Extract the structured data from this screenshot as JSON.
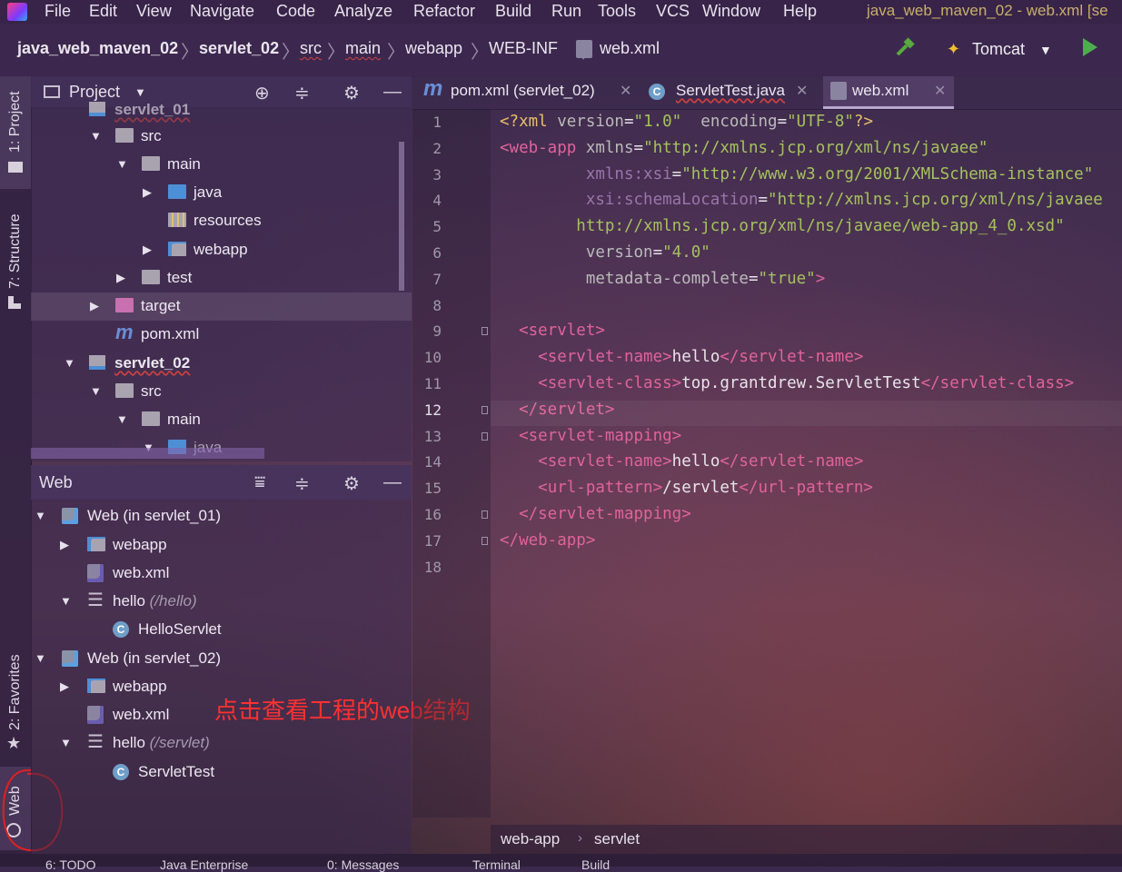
{
  "menu": {
    "items": [
      "File",
      "Edit",
      "View",
      "Navigate",
      "Code",
      "Analyze",
      "Refactor",
      "Build",
      "Run",
      "Tools",
      "VCS",
      "Window",
      "Help"
    ],
    "window_title": "java_web_maven_02 - web.xml [se"
  },
  "navbar": {
    "breadcrumbs": [
      "java_web_maven_02",
      "servlet_02",
      "src",
      "main",
      "webapp",
      "WEB-INF",
      "web.xml"
    ],
    "run_config": "Tomcat"
  },
  "left_tabs": [
    "1: Project",
    "7: Structure",
    "2: Favorites",
    "Web"
  ],
  "project_panel": {
    "title": "Project",
    "rows": [
      {
        "label": "servlet_01",
        "depth": 1,
        "type": "module",
        "partial": true
      },
      {
        "label": "src",
        "depth": 2,
        "type": "folder",
        "expanded": true
      },
      {
        "label": "main",
        "depth": 3,
        "type": "folder",
        "expanded": true
      },
      {
        "label": "java",
        "depth": 4,
        "type": "folder-blue",
        "expanded": false
      },
      {
        "label": "resources",
        "depth": 4,
        "type": "folder-res"
      },
      {
        "label": "webapp",
        "depth": 4,
        "type": "folder-web",
        "expanded": false
      },
      {
        "label": "test",
        "depth": 3,
        "type": "folder",
        "expanded": false
      },
      {
        "label": "target",
        "depth": 2,
        "type": "folder-target",
        "expanded": false
      },
      {
        "label": "pom.xml",
        "depth": 2,
        "type": "maven"
      },
      {
        "label": "servlet_02",
        "depth": 1,
        "type": "module",
        "expanded": true
      },
      {
        "label": "src",
        "depth": 2,
        "type": "folder",
        "expanded": true
      },
      {
        "label": "main",
        "depth": 3,
        "type": "folder",
        "expanded": true
      },
      {
        "label": "java",
        "depth": 4,
        "type": "folder-blue",
        "expanded": true,
        "partial": true
      }
    ]
  },
  "web_panel": {
    "title": "Web",
    "rows": [
      {
        "label": "Web (in servlet_01)",
        "hint": "",
        "depth": 0,
        "type": "web"
      },
      {
        "label": "webapp",
        "hint": "",
        "depth": 1,
        "type": "folder-web"
      },
      {
        "label": "web.xml",
        "hint": "",
        "depth": 1,
        "type": "webxml"
      },
      {
        "label": "hello",
        "hint": "(/hello)",
        "depth": 1,
        "type": "servlet-group"
      },
      {
        "label": "HelloServlet",
        "hint": "",
        "depth": 2,
        "type": "class"
      },
      {
        "label": "Web (in servlet_02)",
        "hint": "",
        "depth": 0,
        "type": "web"
      },
      {
        "label": "webapp",
        "hint": "",
        "depth": 1,
        "type": "folder-web"
      },
      {
        "label": "web.xml",
        "hint": "",
        "depth": 1,
        "type": "webxml"
      },
      {
        "label": "hello",
        "hint": "(/servlet)",
        "depth": 1,
        "type": "servlet-group"
      },
      {
        "label": "ServletTest",
        "hint": "",
        "depth": 2,
        "type": "class"
      }
    ]
  },
  "annotation": "点击查看工程的web结构",
  "editor": {
    "tabs": [
      {
        "label": "pom.xml (servlet_02)",
        "icon": "maven",
        "active": false
      },
      {
        "label": "ServletTest.java",
        "icon": "class",
        "active": false
      },
      {
        "label": "web.xml",
        "icon": "webxml",
        "active": true
      }
    ],
    "current_line": "12",
    "lines": [
      {
        "n": "1",
        "segs": [
          [
            "t-tag",
            "<?xml "
          ],
          [
            "t-attr",
            "version"
          ],
          [
            "",
            "="
          ],
          [
            "t-val",
            "\"1.0\""
          ],
          [
            "",
            "  "
          ],
          [
            "t-attr",
            "encoding"
          ],
          [
            "",
            "="
          ],
          [
            "t-val",
            "\"UTF-8\""
          ],
          [
            "t-tag",
            "?>"
          ]
        ]
      },
      {
        "n": "2",
        "segs": [
          [
            "t-pink",
            "<web-app "
          ],
          [
            "t-attr",
            "xmlns"
          ],
          [
            "",
            "="
          ],
          [
            "t-val",
            "\"http://xmlns.jcp.org/xml/ns/javaee\""
          ]
        ]
      },
      {
        "n": "3",
        "segs": [
          [
            "",
            "         "
          ],
          [
            "t-ns",
            "xmlns:xsi"
          ],
          [
            "",
            "="
          ],
          [
            "t-val",
            "\"http://www.w3.org/2001/XMLSchema-instance\""
          ]
        ]
      },
      {
        "n": "4",
        "segs": [
          [
            "",
            "         "
          ],
          [
            "t-ns",
            "xsi:schemaLocation"
          ],
          [
            "",
            "="
          ],
          [
            "t-val",
            "\"http://xmlns.jcp.org/xml/ns/javaee"
          ]
        ]
      },
      {
        "n": "5",
        "segs": [
          [
            "",
            "        "
          ],
          [
            "t-val",
            "http://xmlns.jcp.org/xml/ns/javaee/web-app_4_0.xsd\""
          ]
        ]
      },
      {
        "n": "6",
        "segs": [
          [
            "",
            "         "
          ],
          [
            "t-attr",
            "version"
          ],
          [
            "",
            "="
          ],
          [
            "t-val",
            "\"4.0\""
          ]
        ]
      },
      {
        "n": "7",
        "segs": [
          [
            "",
            "         "
          ],
          [
            "t-attr",
            "metadata-complete"
          ],
          [
            "",
            "="
          ],
          [
            "t-val",
            "\"true\""
          ],
          [
            "t-pink",
            ">"
          ]
        ]
      },
      {
        "n": "8",
        "segs": []
      },
      {
        "n": "9",
        "segs": [
          [
            "",
            "  "
          ],
          [
            "t-pink",
            "<servlet>"
          ]
        ]
      },
      {
        "n": "10",
        "segs": [
          [
            "",
            "    "
          ],
          [
            "t-pink",
            "<servlet-name>"
          ],
          [
            "",
            "hello"
          ],
          [
            "t-pink",
            "</servlet-name>"
          ]
        ]
      },
      {
        "n": "11",
        "segs": [
          [
            "",
            "    "
          ],
          [
            "t-pink",
            "<servlet-class>"
          ],
          [
            "",
            "top.grantdrew.ServletTest"
          ],
          [
            "t-pink",
            "</servlet-class>"
          ]
        ]
      },
      {
        "n": "12",
        "segs": [
          [
            "",
            "  "
          ],
          [
            "t-pink",
            "</servlet>"
          ]
        ]
      },
      {
        "n": "13",
        "segs": [
          [
            "",
            "  "
          ],
          [
            "t-pink",
            "<servlet-mapping>"
          ]
        ]
      },
      {
        "n": "14",
        "segs": [
          [
            "",
            "    "
          ],
          [
            "t-pink",
            "<servlet-name>"
          ],
          [
            "",
            "hello"
          ],
          [
            "t-pink",
            "</servlet-name>"
          ]
        ]
      },
      {
        "n": "15",
        "segs": [
          [
            "",
            "    "
          ],
          [
            "t-pink",
            "<url-pattern>"
          ],
          [
            "",
            "/servlet"
          ],
          [
            "t-pink",
            "</url-pattern>"
          ]
        ]
      },
      {
        "n": "16",
        "segs": [
          [
            "",
            "  "
          ],
          [
            "t-pink",
            "</servlet-mapping>"
          ]
        ]
      },
      {
        "n": "17",
        "segs": [
          [
            "t-pink",
            "</web-app>"
          ]
        ]
      },
      {
        "n": "18",
        "segs": []
      }
    ],
    "breadcrumb": [
      "web-app",
      "servlet"
    ]
  },
  "bottom_tabs": [
    "6: TODO",
    "Java Enterprise",
    "0: Messages",
    "Terminal",
    "Build"
  ]
}
